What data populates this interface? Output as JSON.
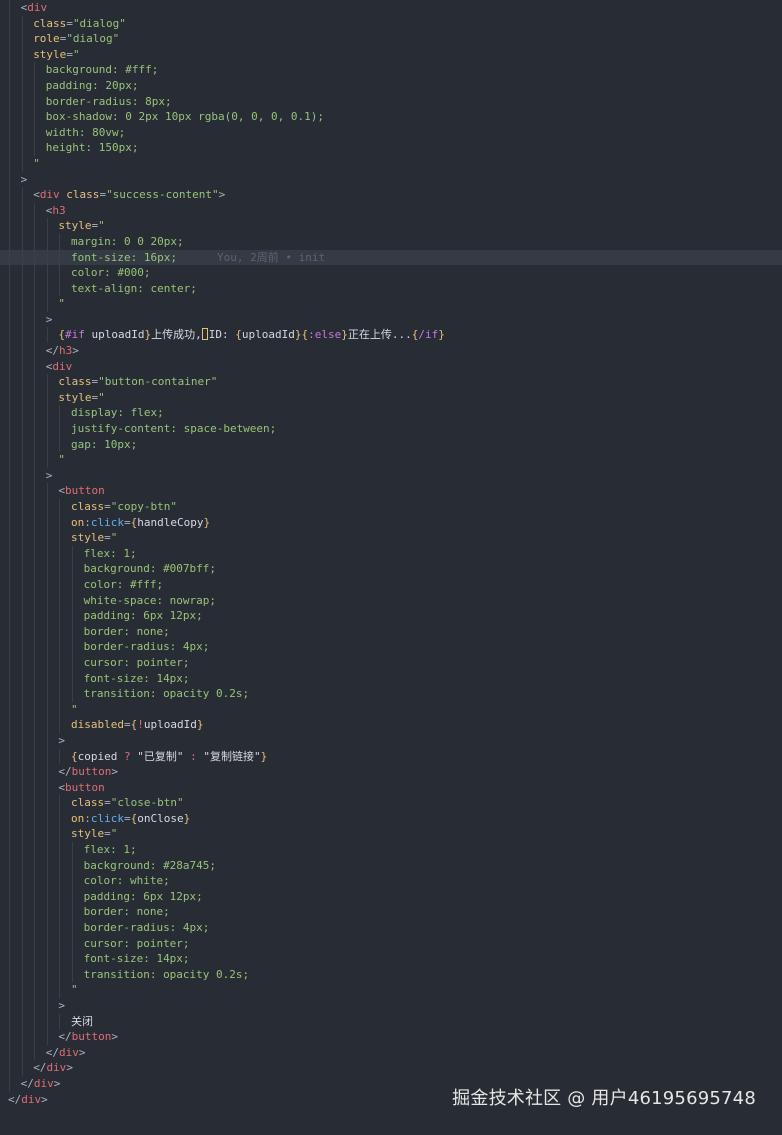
{
  "editor": {
    "lines": [
      {
        "indent": 1,
        "tokens": [
          {
            "t": "<",
            "c": "punc"
          },
          {
            "t": "div",
            "c": "tag"
          }
        ]
      },
      {
        "indent": 2,
        "tokens": [
          {
            "t": "class",
            "c": "attr"
          },
          {
            "t": "=",
            "c": "punc"
          },
          {
            "t": "\"dialog\"",
            "c": "str"
          }
        ]
      },
      {
        "indent": 2,
        "tokens": [
          {
            "t": "role",
            "c": "attr"
          },
          {
            "t": "=",
            "c": "punc"
          },
          {
            "t": "\"dialog\"",
            "c": "str"
          }
        ]
      },
      {
        "indent": 2,
        "tokens": [
          {
            "t": "style",
            "c": "attr"
          },
          {
            "t": "=",
            "c": "punc"
          },
          {
            "t": "\"",
            "c": "str"
          }
        ]
      },
      {
        "indent": 3,
        "tokens": [
          {
            "t": "background: #fff;",
            "c": "str"
          }
        ]
      },
      {
        "indent": 3,
        "tokens": [
          {
            "t": "padding: 20px;",
            "c": "str"
          }
        ]
      },
      {
        "indent": 3,
        "tokens": [
          {
            "t": "border-radius: 8px;",
            "c": "str"
          }
        ]
      },
      {
        "indent": 3,
        "tokens": [
          {
            "t": "box-shadow: 0 2px 10px rgba(0, 0, 0, 0.1);",
            "c": "str"
          }
        ]
      },
      {
        "indent": 3,
        "tokens": [
          {
            "t": "width: 80vw;",
            "c": "str"
          }
        ]
      },
      {
        "indent": 3,
        "tokens": [
          {
            "t": "height: 150px;",
            "c": "str"
          }
        ]
      },
      {
        "indent": 2,
        "tokens": [
          {
            "t": "\"",
            "c": "str"
          }
        ]
      },
      {
        "indent": 1,
        "tokens": [
          {
            "t": ">",
            "c": "punc"
          }
        ]
      },
      {
        "indent": 2,
        "tokens": [
          {
            "t": "<",
            "c": "punc"
          },
          {
            "t": "div",
            "c": "tag"
          },
          {
            "t": " class",
            "c": "attr"
          },
          {
            "t": "=",
            "c": "punc"
          },
          {
            "t": "\"success-content\"",
            "c": "str"
          },
          {
            "t": ">",
            "c": "punc"
          }
        ]
      },
      {
        "indent": 3,
        "tokens": [
          {
            "t": "<",
            "c": "punc"
          },
          {
            "t": "h3",
            "c": "tag"
          }
        ]
      },
      {
        "indent": 4,
        "tokens": [
          {
            "t": "style",
            "c": "attr"
          },
          {
            "t": "=",
            "c": "punc"
          },
          {
            "t": "\"",
            "c": "str"
          }
        ]
      },
      {
        "indent": 5,
        "tokens": [
          {
            "t": "margin: 0 0 20px;",
            "c": "str"
          }
        ]
      },
      {
        "indent": 5,
        "highlight": true,
        "blame": "You, 2周前 • init",
        "tokens": [
          {
            "t": "font-size: 16px;",
            "c": "str"
          }
        ]
      },
      {
        "indent": 5,
        "tokens": [
          {
            "t": "color: #000;",
            "c": "str"
          }
        ]
      },
      {
        "indent": 5,
        "tokens": [
          {
            "t": "text-align: center;",
            "c": "str"
          }
        ]
      },
      {
        "indent": 4,
        "tokens": [
          {
            "t": "\"",
            "c": "str"
          }
        ]
      },
      {
        "indent": 3,
        "tokens": [
          {
            "t": ">",
            "c": "punc"
          }
        ]
      },
      {
        "indent": 4,
        "cursor_after": 4,
        "tokens": [
          {
            "t": "{",
            "c": "brace"
          },
          {
            "t": "#if",
            "c": "kw"
          },
          {
            "t": " uploadId",
            "c": "text"
          },
          {
            "t": "}",
            "c": "brace"
          },
          {
            "t": "上传成功,",
            "c": "text"
          },
          {
            "t": "ID: ",
            "c": "text"
          },
          {
            "t": "{",
            "c": "brace"
          },
          {
            "t": "uploadId",
            "c": "text"
          },
          {
            "t": "}",
            "c": "brace"
          },
          {
            "t": "{",
            "c": "brace"
          },
          {
            "t": ":else",
            "c": "kw"
          },
          {
            "t": "}",
            "c": "brace"
          },
          {
            "t": "正在上传...",
            "c": "text"
          },
          {
            "t": "{",
            "c": "brace"
          },
          {
            "t": "/if",
            "c": "kw"
          },
          {
            "t": "}",
            "c": "brace"
          }
        ]
      },
      {
        "indent": 3,
        "tokens": [
          {
            "t": "</",
            "c": "punc"
          },
          {
            "t": "h3",
            "c": "tag"
          },
          {
            "t": ">",
            "c": "punc"
          }
        ]
      },
      {
        "indent": 3,
        "tokens": [
          {
            "t": "<",
            "c": "punc"
          },
          {
            "t": "div",
            "c": "tag"
          }
        ]
      },
      {
        "indent": 4,
        "tokens": [
          {
            "t": "class",
            "c": "attr"
          },
          {
            "t": "=",
            "c": "punc"
          },
          {
            "t": "\"button-container\"",
            "c": "str"
          }
        ]
      },
      {
        "indent": 4,
        "tokens": [
          {
            "t": "style",
            "c": "attr"
          },
          {
            "t": "=",
            "c": "punc"
          },
          {
            "t": "\"",
            "c": "str"
          }
        ]
      },
      {
        "indent": 5,
        "tokens": [
          {
            "t": "display: flex;",
            "c": "str"
          }
        ]
      },
      {
        "indent": 5,
        "tokens": [
          {
            "t": "justify-content: space-between;",
            "c": "str"
          }
        ]
      },
      {
        "indent": 5,
        "tokens": [
          {
            "t": "gap: 10px;",
            "c": "str"
          }
        ]
      },
      {
        "indent": 4,
        "tokens": [
          {
            "t": "\"",
            "c": "str"
          }
        ]
      },
      {
        "indent": 3,
        "tokens": [
          {
            "t": ">",
            "c": "punc"
          }
        ]
      },
      {
        "indent": 4,
        "tokens": [
          {
            "t": "<",
            "c": "punc"
          },
          {
            "t": "button",
            "c": "tag"
          }
        ]
      },
      {
        "indent": 5,
        "tokens": [
          {
            "t": "class",
            "c": "attr"
          },
          {
            "t": "=",
            "c": "punc"
          },
          {
            "t": "\"copy-btn\"",
            "c": "str"
          }
        ]
      },
      {
        "indent": 5,
        "tokens": [
          {
            "t": "on",
            "c": "attr"
          },
          {
            "t": ":",
            "c": "punc"
          },
          {
            "t": "click",
            "c": "ev"
          },
          {
            "t": "=",
            "c": "punc"
          },
          {
            "t": "{",
            "c": "brace"
          },
          {
            "t": "handleCopy",
            "c": "text"
          },
          {
            "t": "}",
            "c": "brace"
          }
        ]
      },
      {
        "indent": 5,
        "tokens": [
          {
            "t": "style",
            "c": "attr"
          },
          {
            "t": "=",
            "c": "punc"
          },
          {
            "t": "\"",
            "c": "str"
          }
        ]
      },
      {
        "indent": 6,
        "tokens": [
          {
            "t": "flex: 1;",
            "c": "str"
          }
        ]
      },
      {
        "indent": 6,
        "tokens": [
          {
            "t": "background: #007bff;",
            "c": "str"
          }
        ]
      },
      {
        "indent": 6,
        "tokens": [
          {
            "t": "color: #fff;",
            "c": "str"
          }
        ]
      },
      {
        "indent": 6,
        "tokens": [
          {
            "t": "white-space: nowrap;",
            "c": "str"
          }
        ]
      },
      {
        "indent": 6,
        "tokens": [
          {
            "t": "padding: 6px 12px;",
            "c": "str"
          }
        ]
      },
      {
        "indent": 6,
        "tokens": [
          {
            "t": "border: none;",
            "c": "str"
          }
        ]
      },
      {
        "indent": 6,
        "tokens": [
          {
            "t": "border-radius: 4px;",
            "c": "str"
          }
        ]
      },
      {
        "indent": 6,
        "tokens": [
          {
            "t": "cursor: pointer;",
            "c": "str"
          }
        ]
      },
      {
        "indent": 6,
        "tokens": [
          {
            "t": "font-size: 14px;",
            "c": "str"
          }
        ]
      },
      {
        "indent": 6,
        "tokens": [
          {
            "t": "transition: opacity 0.2s;",
            "c": "str"
          }
        ]
      },
      {
        "indent": 5,
        "tokens": [
          {
            "t": "\"",
            "c": "str"
          }
        ]
      },
      {
        "indent": 5,
        "tokens": [
          {
            "t": "disabled",
            "c": "attr"
          },
          {
            "t": "=",
            "c": "punc"
          },
          {
            "t": "{",
            "c": "brace"
          },
          {
            "t": "!",
            "c": "op"
          },
          {
            "t": "uploadId",
            "c": "text"
          },
          {
            "t": "}",
            "c": "brace"
          }
        ]
      },
      {
        "indent": 4,
        "tokens": [
          {
            "t": ">",
            "c": "punc"
          }
        ]
      },
      {
        "indent": 5,
        "tokens": [
          {
            "t": "{",
            "c": "brace"
          },
          {
            "t": "copied ",
            "c": "text"
          },
          {
            "t": "?",
            "c": "op"
          },
          {
            "t": " \"已复制\" ",
            "c": "text"
          },
          {
            "t": ":",
            "c": "op"
          },
          {
            "t": " \"复制链接\"",
            "c": "text"
          },
          {
            "t": "}",
            "c": "brace"
          }
        ]
      },
      {
        "indent": 4,
        "tokens": [
          {
            "t": "</",
            "c": "punc"
          },
          {
            "t": "button",
            "c": "tag"
          },
          {
            "t": ">",
            "c": "punc"
          }
        ]
      },
      {
        "indent": 4,
        "tokens": [
          {
            "t": "<",
            "c": "punc"
          },
          {
            "t": "button",
            "c": "tag"
          }
        ]
      },
      {
        "indent": 5,
        "tokens": [
          {
            "t": "class",
            "c": "attr"
          },
          {
            "t": "=",
            "c": "punc"
          },
          {
            "t": "\"close-btn\"",
            "c": "str"
          }
        ]
      },
      {
        "indent": 5,
        "tokens": [
          {
            "t": "on",
            "c": "attr"
          },
          {
            "t": ":",
            "c": "punc"
          },
          {
            "t": "click",
            "c": "ev"
          },
          {
            "t": "=",
            "c": "punc"
          },
          {
            "t": "{",
            "c": "brace"
          },
          {
            "t": "onClose",
            "c": "text"
          },
          {
            "t": "}",
            "c": "brace"
          }
        ]
      },
      {
        "indent": 5,
        "tokens": [
          {
            "t": "style",
            "c": "attr"
          },
          {
            "t": "=",
            "c": "punc"
          },
          {
            "t": "\"",
            "c": "str"
          }
        ]
      },
      {
        "indent": 6,
        "tokens": [
          {
            "t": "flex: 1;",
            "c": "str"
          }
        ]
      },
      {
        "indent": 6,
        "tokens": [
          {
            "t": "background: #28a745;",
            "c": "str"
          }
        ]
      },
      {
        "indent": 6,
        "tokens": [
          {
            "t": "color: white;",
            "c": "str"
          }
        ]
      },
      {
        "indent": 6,
        "tokens": [
          {
            "t": "padding: 6px 12px;",
            "c": "str"
          }
        ]
      },
      {
        "indent": 6,
        "tokens": [
          {
            "t": "border: none;",
            "c": "str"
          }
        ]
      },
      {
        "indent": 6,
        "tokens": [
          {
            "t": "border-radius: 4px;",
            "c": "str"
          }
        ]
      },
      {
        "indent": 6,
        "tokens": [
          {
            "t": "cursor: pointer;",
            "c": "str"
          }
        ]
      },
      {
        "indent": 6,
        "tokens": [
          {
            "t": "font-size: 14px;",
            "c": "str"
          }
        ]
      },
      {
        "indent": 6,
        "tokens": [
          {
            "t": "transition: opacity 0.2s;",
            "c": "str"
          }
        ]
      },
      {
        "indent": 5,
        "tokens": [
          {
            "t": "\"",
            "c": "str"
          }
        ]
      },
      {
        "indent": 4,
        "tokens": [
          {
            "t": ">",
            "c": "punc"
          }
        ]
      },
      {
        "indent": 5,
        "tokens": [
          {
            "t": "关闭",
            "c": "text"
          }
        ]
      },
      {
        "indent": 4,
        "tokens": [
          {
            "t": "</",
            "c": "punc"
          },
          {
            "t": "button",
            "c": "tag"
          },
          {
            "t": ">",
            "c": "punc"
          }
        ]
      },
      {
        "indent": 3,
        "tokens": [
          {
            "t": "</",
            "c": "punc"
          },
          {
            "t": "div",
            "c": "tag"
          },
          {
            "t": ">",
            "c": "punc"
          }
        ]
      },
      {
        "indent": 2,
        "tokens": [
          {
            "t": "</",
            "c": "punc"
          },
          {
            "t": "div",
            "c": "tag"
          },
          {
            "t": ">",
            "c": "punc"
          }
        ]
      },
      {
        "indent": 1,
        "tokens": [
          {
            "t": "</",
            "c": "punc"
          },
          {
            "t": "div",
            "c": "tag"
          },
          {
            "t": ">",
            "c": "punc"
          }
        ]
      },
      {
        "indent": 0,
        "tokens": [
          {
            "t": "</",
            "c": "punc"
          },
          {
            "t": "div",
            "c": "tag"
          },
          {
            "t": ">",
            "c": "punc"
          }
        ]
      }
    ]
  },
  "watermark": "掘金技术社区 @ 用户46195695748",
  "colors": {
    "background": "#282c34",
    "tag": "#e06c75",
    "attribute": "#e5c07b",
    "string": "#98c379",
    "keyword": "#c678dd",
    "event": "#61afef",
    "text": "#d7dae0",
    "blame": "#5c6370"
  }
}
